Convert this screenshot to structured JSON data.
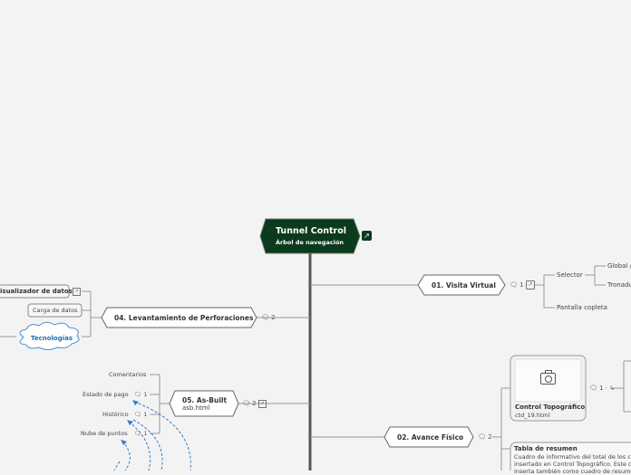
{
  "root": {
    "title": "Tunnel Control",
    "subtitle": "Árbol de navegación"
  },
  "branches": {
    "visita_virtual": {
      "label": "01. Visita Virtual",
      "badge": "1 ·",
      "children": {
        "selector": "Selector",
        "selector_children": [
          "Global /",
          "Tronadu"
        ],
        "pantalla": "Pantalla copleta"
      }
    },
    "avance_fisico": {
      "label": "02. Avance Físico",
      "badge": "2",
      "card": {
        "title": "Control Topográfico",
        "file": "ctd_19.html",
        "badge": "1 ·"
      },
      "resumen": {
        "title": "Tabla de resumen",
        "lines": [
          "Cuadro de informativo del total de los c",
          "insertado en Control Topográfico. Este c",
          "inserta también como cuadro de resume"
        ]
      }
    },
    "levantamiento": {
      "label": "04. Levantamiento de Perforaciones",
      "badge": "2",
      "children": {
        "visualizador": "isualizador de datos",
        "carga": "Carga de datos",
        "tecnologias": "Tecnologías"
      }
    },
    "asbuilt": {
      "label": "05. As-Built",
      "file": "asb.html",
      "badge": "2 ·",
      "children": [
        {
          "label": "Comentarios",
          "badge": ""
        },
        {
          "label": "Estado de pago",
          "badge": "1"
        },
        {
          "label": "Histórico",
          "badge": "1"
        },
        {
          "label": "Nube de puntos",
          "badge": "1"
        }
      ]
    }
  },
  "colors": {
    "root_bg": "#0b3a1c",
    "trunk": "#555555",
    "connector": "#9a9a9a",
    "dashed_link": "#2f7fd0",
    "cloud_text": "#1f6fb0"
  }
}
